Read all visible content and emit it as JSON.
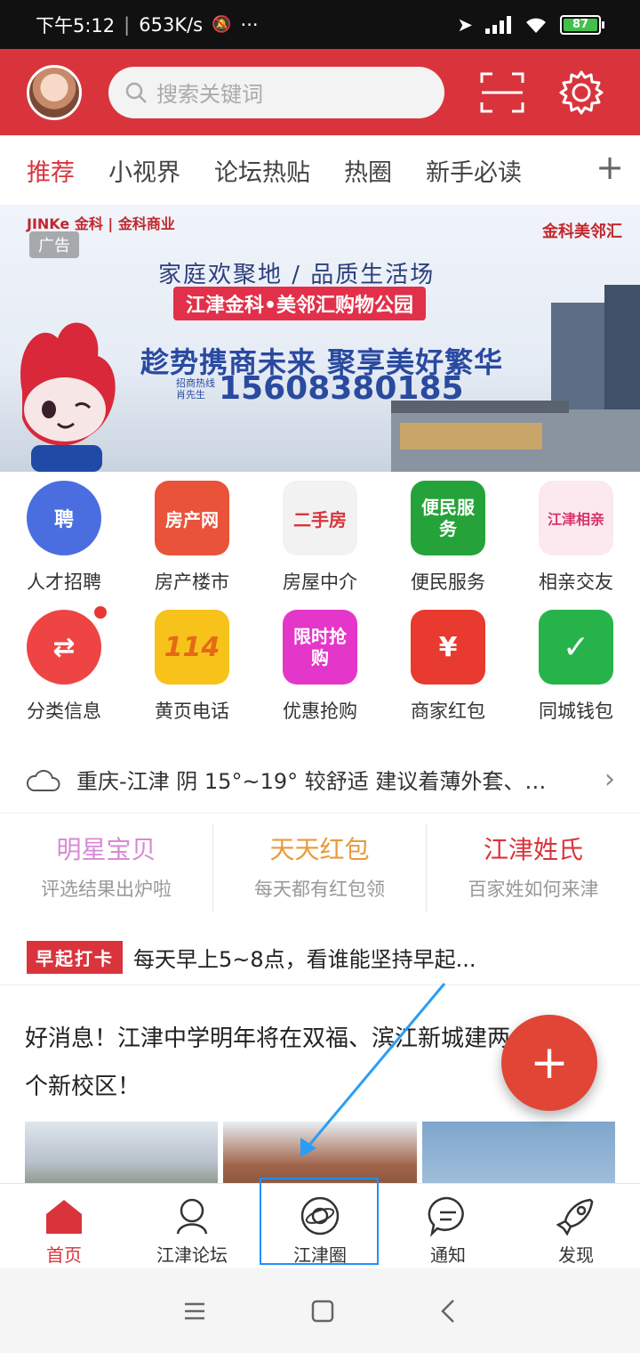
{
  "status_bar": {
    "time": "下午5:12",
    "speed": "653K/s",
    "dots": "···",
    "battery": "87"
  },
  "search": {
    "placeholder": "搜索关键词"
  },
  "tabs": [
    {
      "label": "推荐",
      "active": true
    },
    {
      "label": "小视界"
    },
    {
      "label": "论坛热贴"
    },
    {
      "label": "热圈"
    },
    {
      "label": "新手必读"
    }
  ],
  "tabs_plus": "+",
  "banner": {
    "ad_tag": "广告",
    "brand_left": "JINKe 金科 | 金科商业",
    "brand_right": "金科美邻汇",
    "line1": "家庭欢聚地 / 品质生活场",
    "pill": "江津金科•美邻汇购物公园",
    "line2": "趁势携商未来 聚享美好繁华",
    "hotline_label_1": "招商热线",
    "hotline_label_2": "肖先生",
    "phone": "15608380185"
  },
  "grid": [
    {
      "label": "人才招聘",
      "icon_text": "聘",
      "color": "#4a6ee0"
    },
    {
      "label": "房产楼市",
      "icon_text": "房产网",
      "color": "#e9533a"
    },
    {
      "label": "房屋中介",
      "icon_text": "二手房",
      "color": "#f2f2f2"
    },
    {
      "label": "便民服务",
      "icon_text": "便民服务",
      "color": "#25a33a"
    },
    {
      "label": "相亲交友",
      "icon_text": "江津相亲",
      "color": "#fbe9ef"
    },
    {
      "label": "分类信息",
      "icon_text": "⇄",
      "color": "#ef4444"
    },
    {
      "label": "黄页电话",
      "icon_text": "114",
      "color": "#f7c21a"
    },
    {
      "label": "优惠抢购",
      "icon_text": "限时抢购",
      "color": "#e436c9"
    },
    {
      "label": "商家红包",
      "icon_text": "¥",
      "color": "#e83a2e"
    },
    {
      "label": "同城钱包",
      "icon_text": "✓",
      "color": "#26b34a"
    }
  ],
  "weather": {
    "text": "重庆-江津 阴 15°~19° 较舒适 建议着薄外套、…"
  },
  "features": [
    {
      "title": "明星宝贝",
      "sub": "评选结果出炉啦",
      "color": "#d68ad4"
    },
    {
      "title": "天天红包",
      "sub": "每天都有红包领",
      "color": "#e89a3c"
    },
    {
      "title": "江津姓氏",
      "sub": "百家姓如何来津",
      "color": "#d9343c"
    }
  ],
  "checkin": {
    "badge": "早起打卡",
    "text": "每天早上5~8点，看谁能坚持早起..."
  },
  "news": {
    "line1": "好消息！江津中学明年将在双福、滨江新城建两",
    "line2": "个新校区！"
  },
  "fab": "+",
  "bottom_nav": [
    {
      "label": "首页",
      "active": true
    },
    {
      "label": "江津论坛"
    },
    {
      "label": "江津圈"
    },
    {
      "label": "通知"
    },
    {
      "label": "发现"
    }
  ]
}
